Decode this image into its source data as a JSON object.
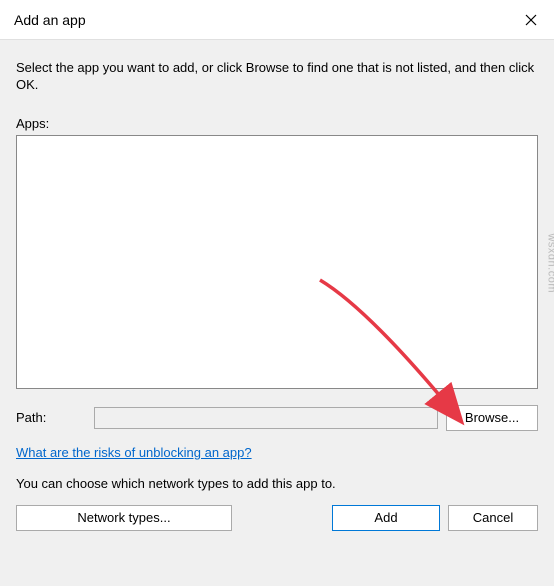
{
  "window": {
    "title": "Add an app"
  },
  "instruction": "Select the app you want to add, or click Browse to find one that is not listed, and then click OK.",
  "labels": {
    "apps": "Apps:",
    "path": "Path:"
  },
  "path": {
    "value": ""
  },
  "buttons": {
    "browse": "Browse...",
    "network_types": "Network types...",
    "add": "Add",
    "cancel": "Cancel"
  },
  "link": {
    "risks": "What are the risks of unblocking an app?"
  },
  "network_text": "You can choose which network types to add this app to.",
  "watermark": "wsxdn.com"
}
